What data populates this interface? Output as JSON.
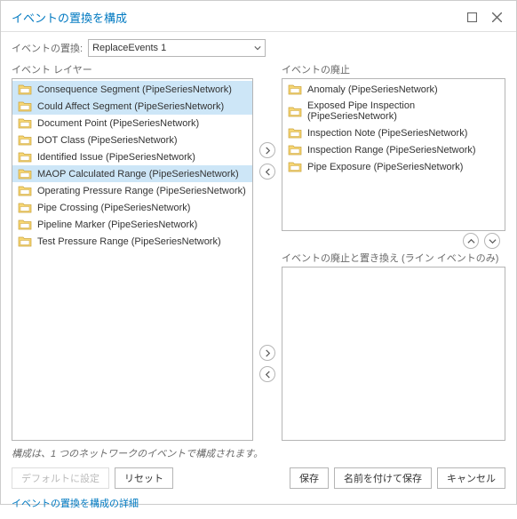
{
  "window": {
    "title": "イベントの置換を構成"
  },
  "field": {
    "label": "イベントの置換:",
    "value": "ReplaceEvents 1"
  },
  "left": {
    "label": "イベント レイヤー",
    "items": [
      {
        "label": "Consequence Segment (PipeSeriesNetwork)",
        "selected": true
      },
      {
        "label": "Could Affect Segment (PipeSeriesNetwork)",
        "selected": true
      },
      {
        "label": "Document Point (PipeSeriesNetwork)",
        "selected": false
      },
      {
        "label": "DOT Class (PipeSeriesNetwork)",
        "selected": false
      },
      {
        "label": "Identified Issue (PipeSeriesNetwork)",
        "selected": false
      },
      {
        "label": "MAOP Calculated Range (PipeSeriesNetwork)",
        "selected": true
      },
      {
        "label": "Operating Pressure Range (PipeSeriesNetwork)",
        "selected": false
      },
      {
        "label": "Pipe Crossing (PipeSeriesNetwork)",
        "selected": false
      },
      {
        "label": "Pipeline Marker (PipeSeriesNetwork)",
        "selected": false
      },
      {
        "label": "Test Pressure Range (PipeSeriesNetwork)",
        "selected": false
      }
    ]
  },
  "rightTop": {
    "label": "イベントの廃止",
    "items": [
      {
        "label": "Anomaly (PipeSeriesNetwork)"
      },
      {
        "label": "Exposed Pipe Inspection (PipeSeriesNetwork)"
      },
      {
        "label": "Inspection Note (PipeSeriesNetwork)"
      },
      {
        "label": "Inspection Range (PipeSeriesNetwork)"
      },
      {
        "label": "Pipe Exposure (PipeSeriesNetwork)"
      }
    ]
  },
  "rightBottom": {
    "label": "イベントの廃止と置き換え (ライン イベントのみ)",
    "items": []
  },
  "footer": {
    "note": "構成は、1 つのネットワークのイベントで構成されます。",
    "buttons": {
      "default": "デフォルトに設定",
      "reset": "リセット",
      "save": "保存",
      "saveAs": "名前を付けて保存",
      "cancel": "キャンセル"
    },
    "link": "イベントの置換を構成の詳細"
  }
}
